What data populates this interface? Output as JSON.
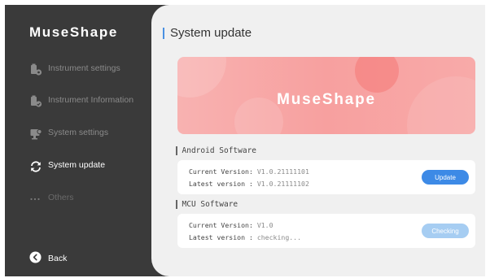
{
  "app": {
    "brand": "MuseShape"
  },
  "sidebar": {
    "items": [
      {
        "label": "Instrument settings",
        "icon": "instrument-settings-icon",
        "active": false
      },
      {
        "label": "Instrument Information",
        "icon": "instrument-info-icon",
        "active": false
      },
      {
        "label": "System settings",
        "icon": "system-settings-icon",
        "active": false
      },
      {
        "label": "System update",
        "icon": "refresh-icon",
        "active": true
      },
      {
        "label": "Others",
        "icon": "more-dots-icon",
        "active": false
      }
    ],
    "back_label": "Back"
  },
  "main": {
    "title": "System update",
    "banner_text": "MuseShape",
    "sections": [
      {
        "title": "Android Software",
        "current_label": "Current Version:",
        "current_value": "V1.0.21111101",
        "latest_label": "Latest version :",
        "latest_value": "V1.0.21111102",
        "button_label": "Update",
        "button_state": "enabled"
      },
      {
        "title": "MCU Software",
        "current_label": "Current Version:",
        "current_value": "V1.0",
        "latest_label": "Latest version :",
        "latest_value": "checking...",
        "button_label": "Checking",
        "button_state": "disabled"
      }
    ]
  },
  "colors": {
    "sidebar_bg": "#3a3a3a",
    "main_bg": "#f0f0f0",
    "accent": "#3d8ae6",
    "accent_disabled": "#a6cdf2",
    "banner": "#f7a09f"
  }
}
